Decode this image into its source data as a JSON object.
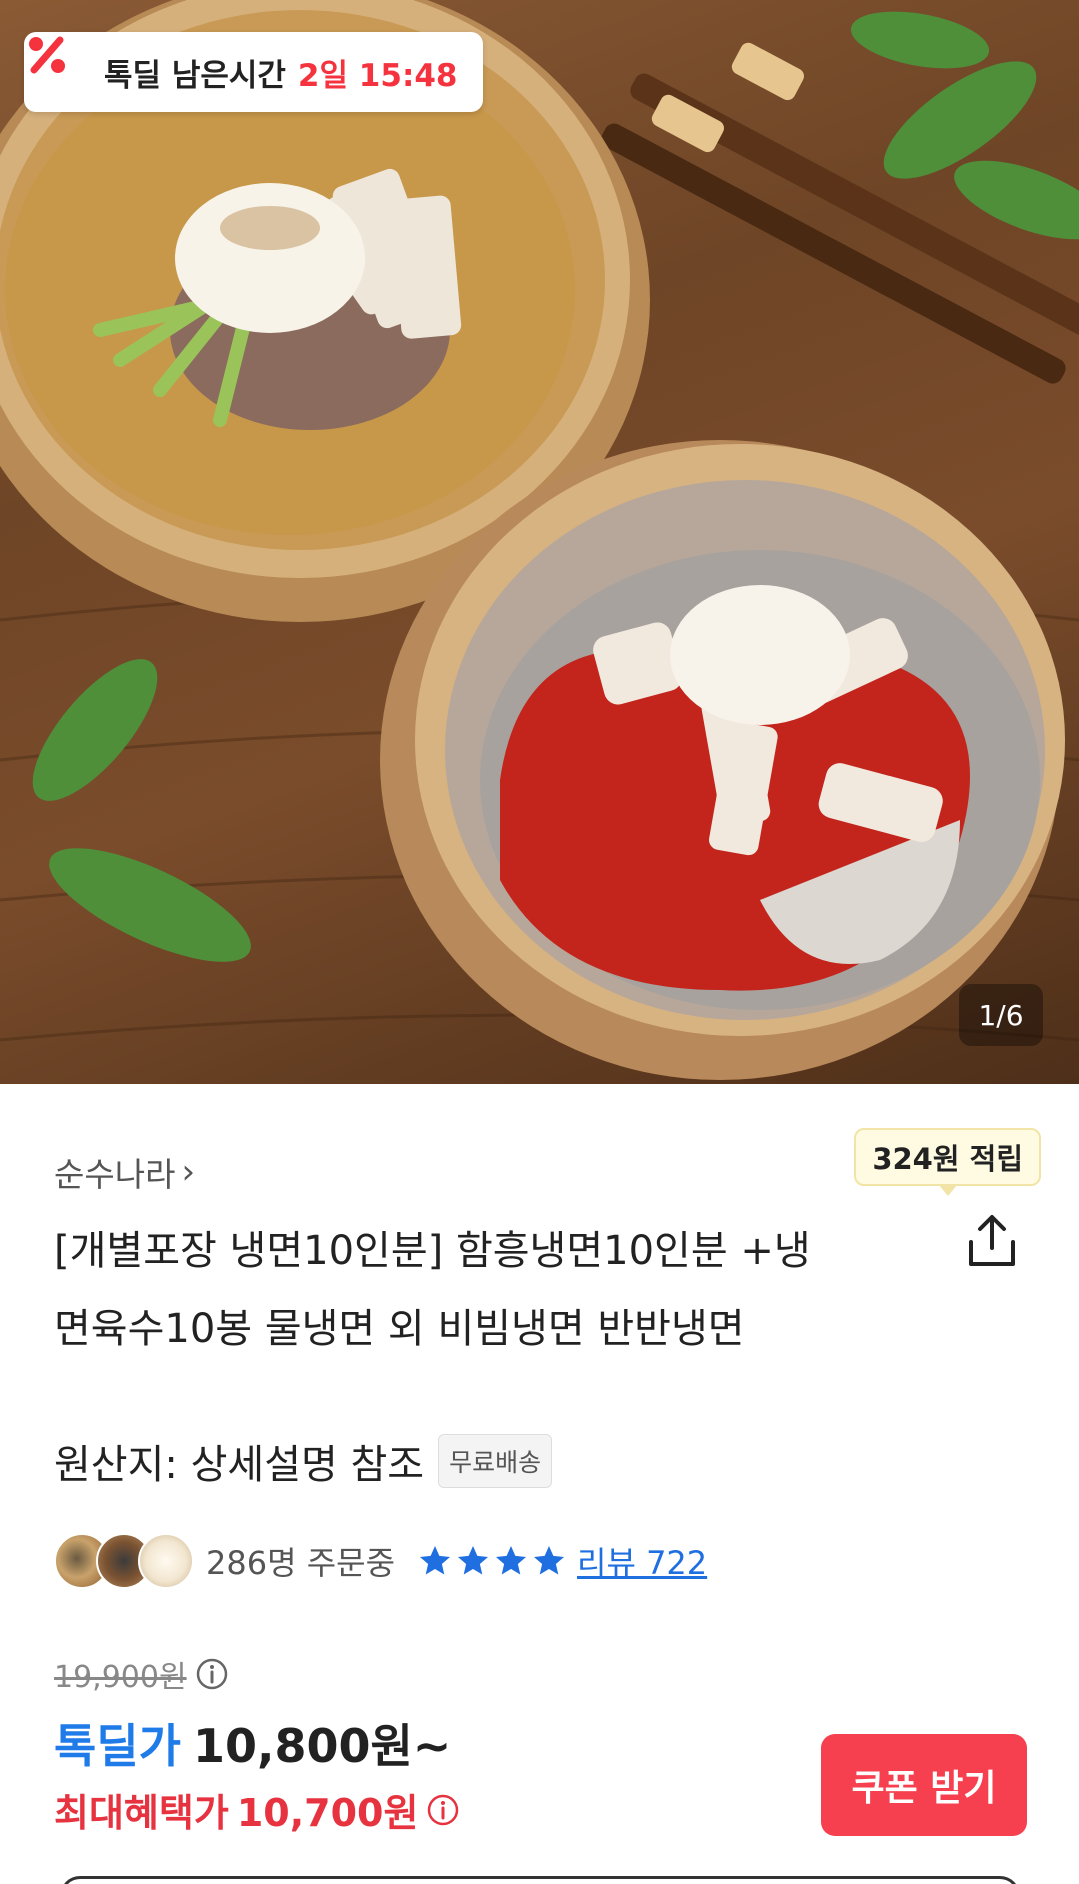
{
  "hero": {
    "deal_timer_label": "톡딜 남은시간",
    "deal_timer_value": "2일 15:48",
    "image_counter": "1/6"
  },
  "product": {
    "seller": "순수나라",
    "reward_points": "324원 적립",
    "title": "[개별포장 냉면10인분] 함흥냉면10인분 +냉면육수10봉 물냉면 외 비빔냉면 반반냉면",
    "origin": "원산지: 상세설명 참조",
    "shipping_badge": "무료배송",
    "order_count": "286명 주문중",
    "rating_stars": 4,
    "review_label": "리뷰 722"
  },
  "pricing": {
    "original_price": "19,900원",
    "deal_label": "톡딜가",
    "deal_price": "10,800원~",
    "max_benefit_label": "최대혜택가",
    "max_benefit_price": "10,700원",
    "coupon_button": "쿠폰 받기"
  },
  "colors": {
    "accent_red": "#f5333f",
    "deal_blue": "#1f7be8",
    "link_blue": "#1f6fe0",
    "coupon_bg": "#f6404f"
  },
  "icons": {
    "timer": "percent-badge-icon",
    "share": "share-icon",
    "info": "info-icon",
    "star": "star-icon",
    "chevron": "chevron-right-icon"
  }
}
